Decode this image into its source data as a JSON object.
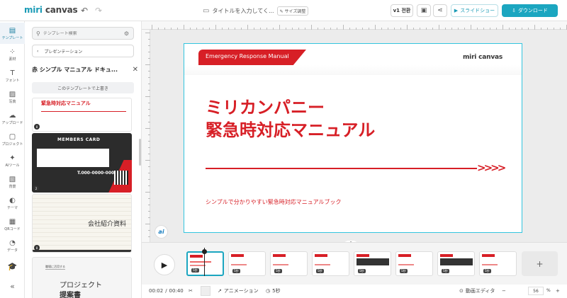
{
  "header": {
    "logo_prefix": "miri",
    "logo_suffix": "canvas",
    "doc_title": "タイトルを入力してく...",
    "size_button": "サイズ調整",
    "version_button": "v1 전환",
    "slideshow_button": "スライドショー",
    "download_button": "ダウンロード"
  },
  "rail": {
    "items": [
      {
        "label": "テンプレート",
        "icon": "template-icon"
      },
      {
        "label": "素材",
        "icon": "elements-icon"
      },
      {
        "label": "フォント",
        "icon": "font-icon"
      },
      {
        "label": "写真",
        "icon": "photo-icon"
      },
      {
        "label": "アップロード",
        "icon": "upload-icon"
      },
      {
        "label": "プロジェクト",
        "icon": "project-icon"
      },
      {
        "label": "AIツール",
        "icon": "ai-tool-icon"
      },
      {
        "label": "背景",
        "icon": "background-icon"
      },
      {
        "label": "テーマ",
        "icon": "theme-icon"
      },
      {
        "label": "QRコード",
        "icon": "qr-icon"
      },
      {
        "label": "データ",
        "icon": "data-icon"
      }
    ]
  },
  "panel": {
    "search_placeholder": "テンプレート検索",
    "category": "プレゼンテーション",
    "template_title": "赤 シンプル マニュアル ドキュ...",
    "overwrite_button": "このテンプレートで上書き",
    "thumbs": {
      "t1_title": "緊急時対応マニュアル",
      "t1_num": "8",
      "t2_title": "MEMBERS CARD",
      "t2_phone": "T.000-0000-0000",
      "t2_num": "2",
      "t3_title": "会社紹介資料",
      "t3_num": "8",
      "t4_small": "職場に活用する",
      "t4_line1": "プロジェクト",
      "t4_line2": "提案書"
    }
  },
  "slide": {
    "banner": "Emergency Response Manual",
    "logo": "miri canvas",
    "title_line1": "ミリカンパニー",
    "title_line2": "緊急時対応マニュアル",
    "arrows": ">>>>",
    "subtitle": "シンプルで分かりやすい緊急時対応マニュアルブック"
  },
  "ai_button": "ai",
  "timeline": {
    "pages": [
      "5秒",
      "5秒",
      "5秒",
      "5秒",
      "5秒",
      "5秒",
      "5秒",
      "5秒"
    ],
    "add": "+"
  },
  "bottombar": {
    "time_current": "00:02",
    "time_sep": "/",
    "time_total": "00:40",
    "animation": "アニメーション",
    "duration": "5秒",
    "video_editor": "動画エディタ",
    "zoom_minus": "−",
    "zoom_value": "56",
    "zoom_unit": "%",
    "zoom_plus": "+"
  }
}
